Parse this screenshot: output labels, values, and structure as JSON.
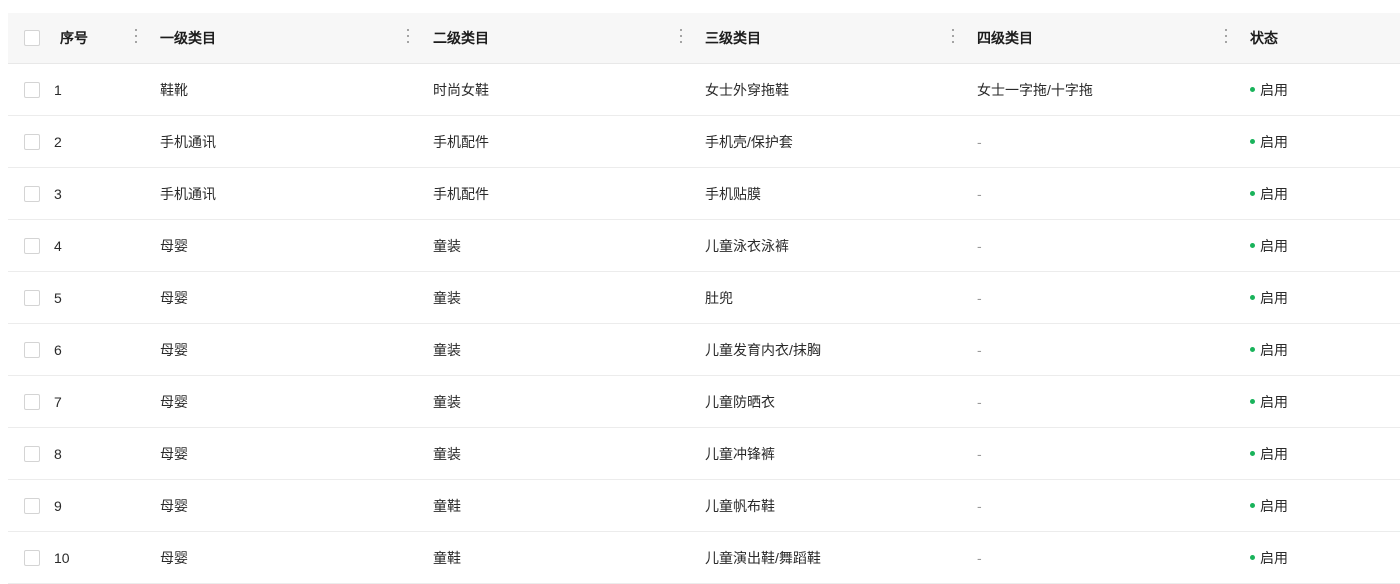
{
  "headers": {
    "index": "序号",
    "level1": "一级类目",
    "level2": "二级类目",
    "level3": "三级类目",
    "level4": "四级类目",
    "status": "状态"
  },
  "status_color": "#19b35b",
  "rows": [
    {
      "index": "1",
      "level1": "鞋靴",
      "level2": "时尚女鞋",
      "level3": "女士外穿拖鞋",
      "level4": "女士一字拖/十字拖",
      "status": "启用"
    },
    {
      "index": "2",
      "level1": "手机通讯",
      "level2": "手机配件",
      "level3": "手机壳/保护套",
      "level4": "-",
      "status": "启用"
    },
    {
      "index": "3",
      "level1": "手机通讯",
      "level2": "手机配件",
      "level3": "手机贴膜",
      "level4": "-",
      "status": "启用"
    },
    {
      "index": "4",
      "level1": "母婴",
      "level2": "童装",
      "level3": "儿童泳衣泳裤",
      "level4": "-",
      "status": "启用"
    },
    {
      "index": "5",
      "level1": "母婴",
      "level2": "童装",
      "level3": "肚兜",
      "level4": "-",
      "status": "启用"
    },
    {
      "index": "6",
      "level1": "母婴",
      "level2": "童装",
      "level3": "儿童发育内衣/抹胸",
      "level4": "-",
      "status": "启用"
    },
    {
      "index": "7",
      "level1": "母婴",
      "level2": "童装",
      "level3": "儿童防晒衣",
      "level4": "-",
      "status": "启用"
    },
    {
      "index": "8",
      "level1": "母婴",
      "level2": "童装",
      "level3": "儿童冲锋裤",
      "level4": "-",
      "status": "启用"
    },
    {
      "index": "9",
      "level1": "母婴",
      "level2": "童鞋",
      "level3": "儿童帆布鞋",
      "level4": "-",
      "status": "启用"
    },
    {
      "index": "10",
      "level1": "母婴",
      "level2": "童鞋",
      "level3": "儿童演出鞋/舞蹈鞋",
      "level4": "-",
      "status": "启用"
    }
  ]
}
